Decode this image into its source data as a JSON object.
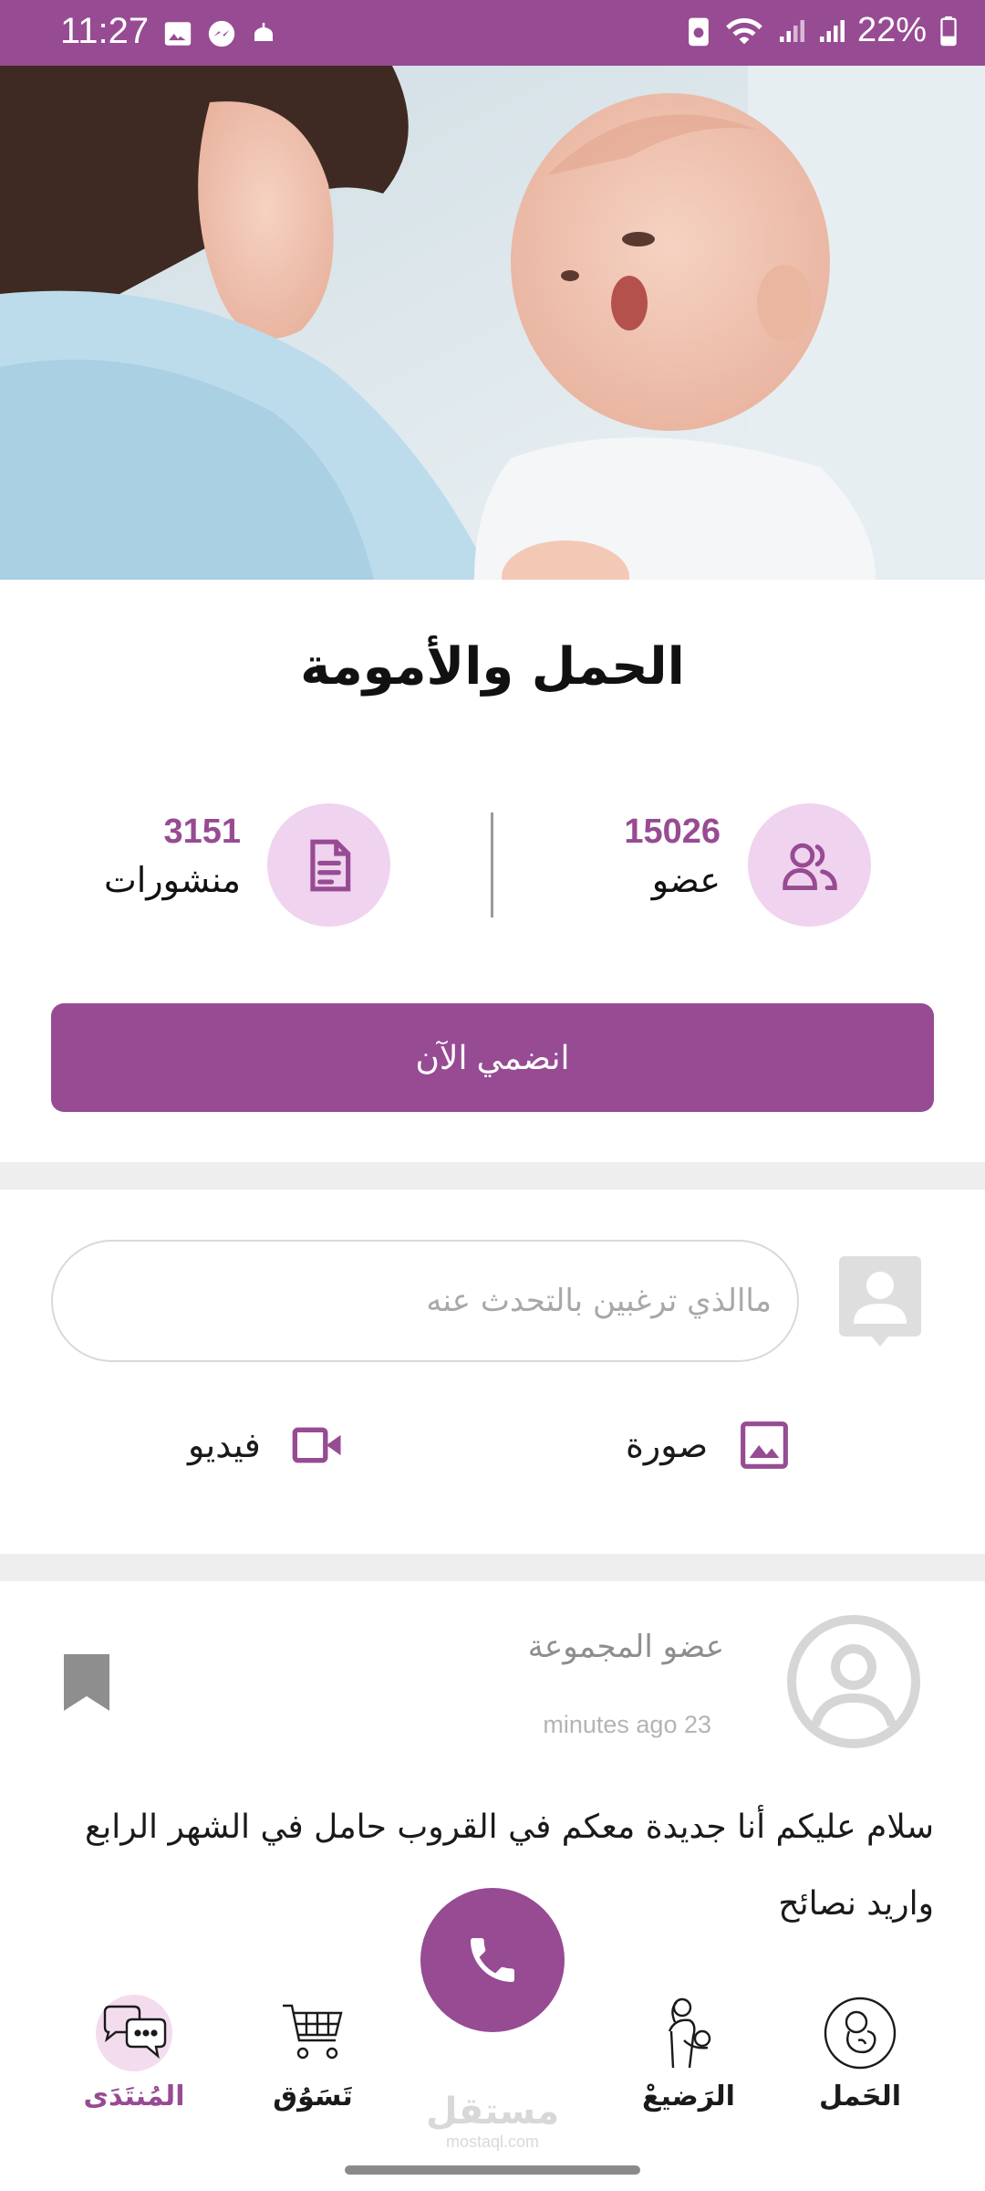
{
  "status_bar": {
    "time": "11:27",
    "battery": "22%",
    "left_icons": [
      "gallery-icon",
      "messenger-icon",
      "mosque-icon"
    ],
    "right_icons": [
      "battery-saver-icon",
      "wifi-icon",
      "signal-icon",
      "signal-icon",
      "battery-icon"
    ]
  },
  "group": {
    "title": "الحمل والأمومة",
    "members_count": "15026",
    "members_label": "عضو",
    "posts_count": "3151",
    "posts_label": "منشورات",
    "join_label": "انضمي الآن"
  },
  "composer": {
    "placeholder": "ماالذي ترغبين بالتحدث عنه",
    "photo_label": "صورة",
    "video_label": "فيديو"
  },
  "post": {
    "author": "عضو المجموعة",
    "time": "minutes ago 23",
    "body": "سلام عليكم أنا جديدة معكم في القروب حامل في الشهر الرابع واريد نصائح"
  },
  "bottom_nav": {
    "items": [
      {
        "label": "الحَمل",
        "icon": "fetus-icon"
      },
      {
        "label": "الرَضيعْ",
        "icon": "mother-baby-icon"
      },
      {
        "label": "تَسَوُق",
        "icon": "cart-icon"
      },
      {
        "label": "المُنتَدَى",
        "icon": "chat-bubbles-icon"
      }
    ],
    "active_index": 3
  },
  "watermark": {
    "arabic": "مستقل",
    "latin": "mostaql.com"
  },
  "colors": {
    "primary": "#974b93",
    "stat_circle": "#f0d3ef",
    "separator": "#eeeeee"
  }
}
